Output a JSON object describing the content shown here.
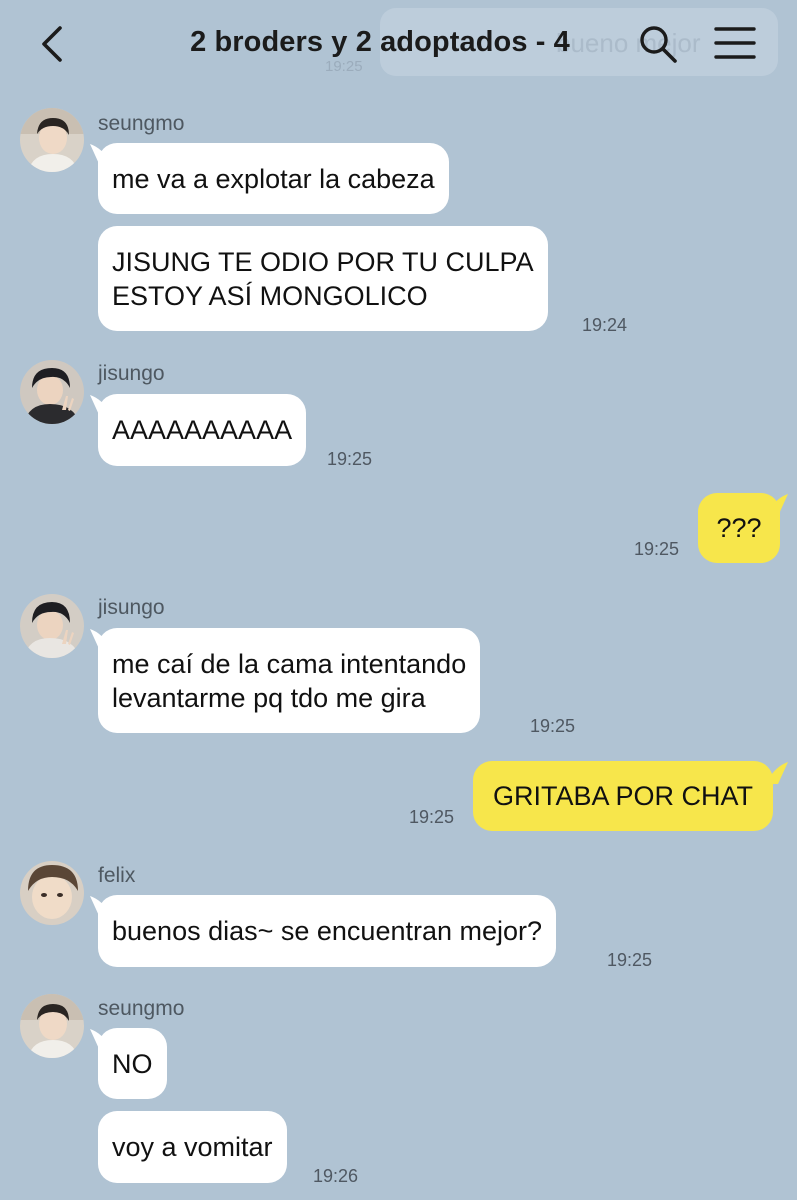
{
  "header": {
    "title": "2 broders y 2 adoptados - 4",
    "overlay_text": "bueno mejor",
    "overlay_time": "19:25"
  },
  "colors": {
    "background": "#b0c3d3",
    "incoming_bubble": "#ffffff",
    "outgoing_bubble": "#f7e64b"
  },
  "messages": [
    {
      "sender": "seungmo",
      "lines": [
        "me va a explotar la cabeza"
      ]
    },
    {
      "sender": "seungmo",
      "lines": [
        "JISUNG TE ODIO POR TU CULPA",
        "ESTOY ASÍ MONGOLICO"
      ],
      "time": "19:24"
    },
    {
      "sender": "jisungo",
      "lines": [
        "AAAAAAAAAA"
      ],
      "time": "19:25"
    },
    {
      "sender": "me",
      "lines": [
        "???"
      ],
      "time": "19:25"
    },
    {
      "sender": "jisungo",
      "lines": [
        "me caí de la cama intentando",
        "levantarme pq tdo me gira"
      ],
      "time": "19:25"
    },
    {
      "sender": "me",
      "lines": [
        "GRITABA POR CHAT"
      ],
      "time": "19:25"
    },
    {
      "sender": "felix",
      "lines": [
        "buenos dias~ se encuentran mejor?"
      ],
      "time": "19:25"
    },
    {
      "sender": "seungmo",
      "lines": [
        "NO"
      ]
    },
    {
      "sender": "seungmo",
      "lines": [
        "voy a vomitar"
      ],
      "time": "19:26"
    }
  ],
  "senders": {
    "seungmo": "seungmo",
    "jisungo": "jisungo",
    "felix": "felix"
  }
}
